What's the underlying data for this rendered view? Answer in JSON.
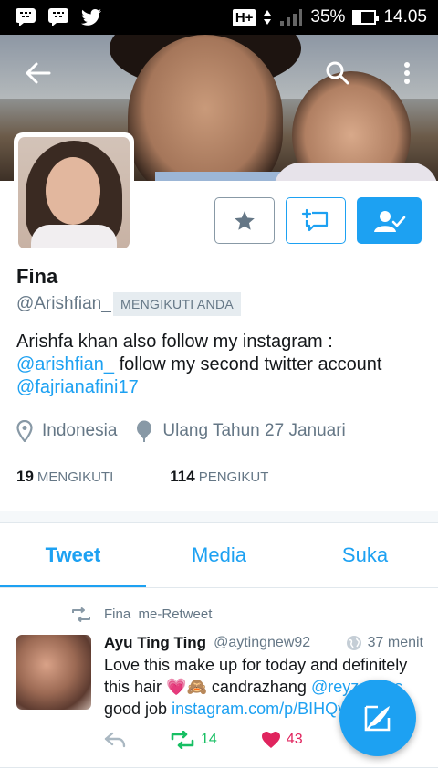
{
  "status_bar": {
    "network": "H+",
    "battery_text": "35%",
    "battery_level": 0.35,
    "time": "14.05",
    "left_icons": [
      "bbm-icon",
      "bbm-icon",
      "twitter-bird-icon"
    ]
  },
  "profile": {
    "name": "Fina",
    "handle": "@Arishfian_",
    "follows_you_badge": "MENGIKUTI ANDA",
    "bio_prefix": "Arishfa khan also follow my instagram :",
    "bio_link1": "@arishfian_",
    "bio_middle": " follow my second twitter account",
    "bio_link2": "@fajrianafini17",
    "location": "Indonesia",
    "birthday": "Ulang Tahun 27 Januari",
    "following_count": "19",
    "following_label": "MENGIKUTI",
    "followers_count": "114",
    "followers_label": "PENGIKUT"
  },
  "tabs": [
    {
      "label": "Tweet",
      "active": true
    },
    {
      "label": "Media",
      "active": false
    },
    {
      "label": "Suka",
      "active": false
    }
  ],
  "tweet": {
    "retweeted_by": "Fina",
    "retweet_label": "me-Retweet",
    "author_name": "Ayu Ting Ting",
    "author_handle": "@aytingnew92",
    "time": "37 menit",
    "text_line1": "Love this make up for today and definitely",
    "text_line2_prefix": "this hair 💗🙈",
    "text_line2_mid": " candrazhang ",
    "text_line2_link": "@reyzcarlos",
    "text_line3_prefix": "good job ",
    "text_line3_link": "instagram.com/p/BIHQv",
    "retweet_count": "14",
    "like_count": "43"
  },
  "colors": {
    "accent": "#1da1f2",
    "secondary_text": "#657786",
    "retweet_green": "#17bf63",
    "like_red": "#e0245e"
  }
}
